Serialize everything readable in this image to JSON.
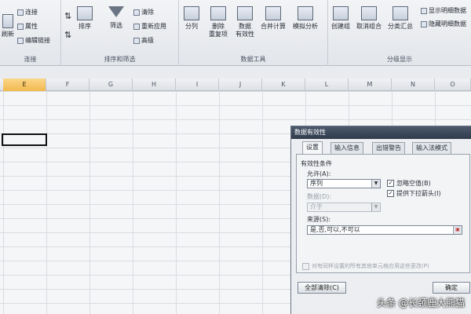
{
  "ribbon": {
    "connections": {
      "label": "连接",
      "refresh": "刷新",
      "connect": "连接",
      "properties": "属性",
      "edit_links": "编辑链接"
    },
    "sort_filter": {
      "label": "排序和筛选",
      "sort": "排序",
      "filter": "筛选",
      "clear": "清除",
      "reapply": "重新应用",
      "advanced": "高级"
    },
    "data_tools": {
      "label": "数据工具",
      "split": "分列",
      "remove_dup_1": "删除",
      "remove_dup_2": "重复项",
      "validation_1": "数据",
      "validation_2": "有效性",
      "consolidate": "合并计算",
      "whatif": "模拟分析"
    },
    "outline": {
      "label": "分级显示",
      "group": "创建组",
      "ungroup": "取消组合",
      "subtotal": "分类汇总",
      "show_detail": "显示明细数据",
      "hide_detail": "隐藏明细数据"
    }
  },
  "sheet": {
    "columns": [
      "E",
      "F",
      "G",
      "H",
      "I",
      "J",
      "K",
      "L",
      "M",
      "N",
      "O"
    ],
    "selected_column": "E"
  },
  "dialog": {
    "title": "数据有效性",
    "tabs": [
      "设置",
      "输入信息",
      "出错警告",
      "输入法模式"
    ],
    "criteria_label": "有效性条件",
    "allow_label": "允许(A):",
    "allow_value": "序列",
    "ignore_blank": "忽略空值(B)",
    "dropdown": "提供下拉箭头(I)",
    "data_label": "数据(D):",
    "data_value": "介于",
    "source_label": "来源(S):",
    "source_value": "是,否,可以,不可以",
    "apply_all": "对有同样设置的所有其他单元格应用这些更改(P)",
    "clear_all": "全部清除(C)",
    "ok": "确定"
  },
  "watermark": "头条 @长颈鹿大熊猫"
}
